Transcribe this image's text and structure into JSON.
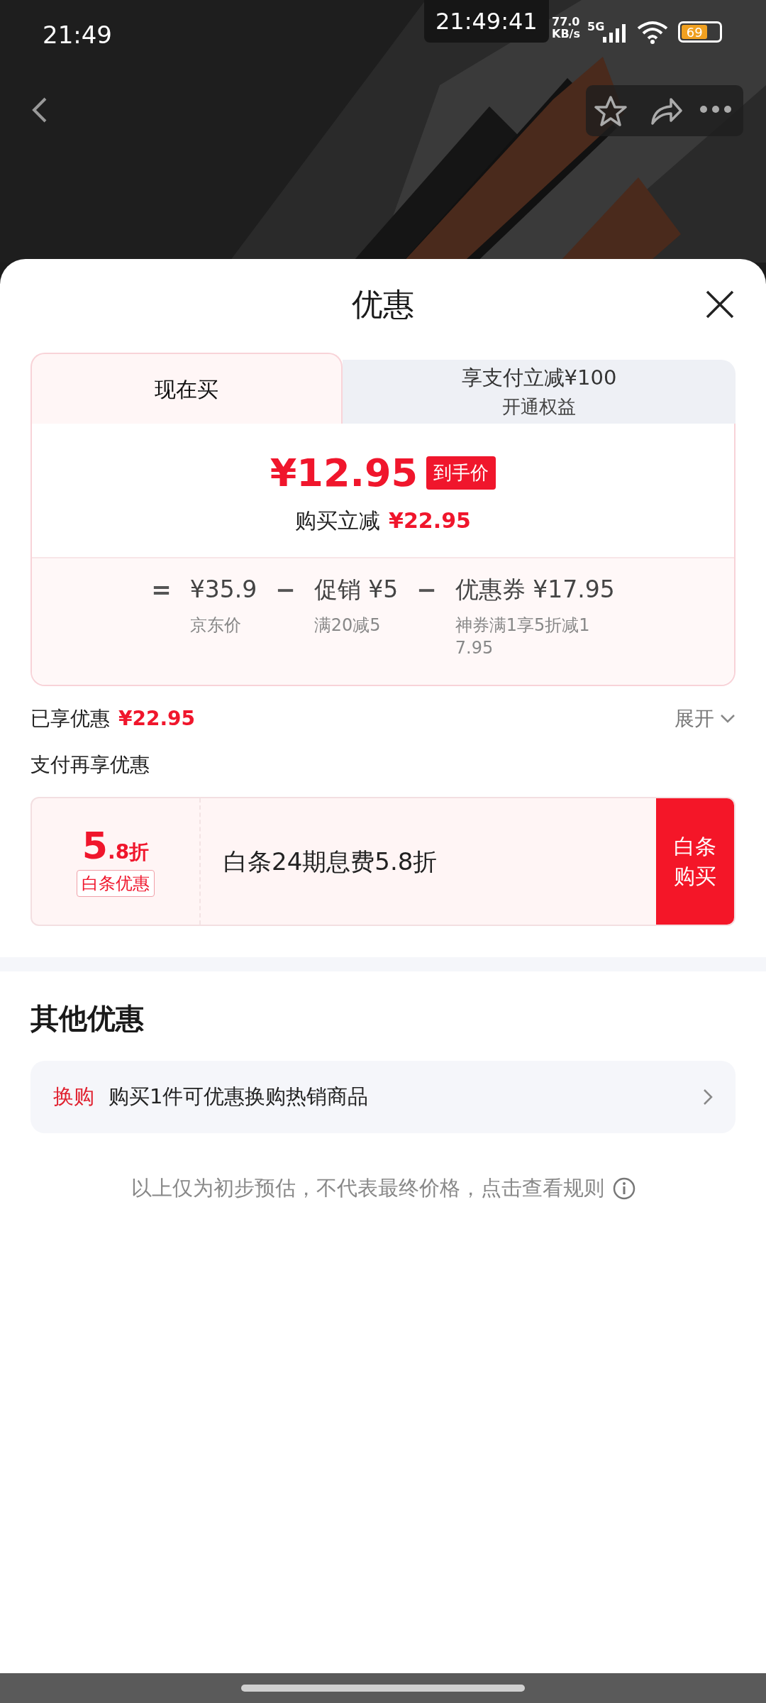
{
  "status_bar": {
    "time": "21:49",
    "floating_clock": "21:49:41",
    "net_speed": [
      "77.0",
      "KB/s"
    ],
    "network": "5G",
    "battery": "69"
  },
  "sheet": {
    "title": "优惠",
    "tabs": [
      {
        "label": "现在买",
        "selected": true
      },
      {
        "label": "享支付立减¥100",
        "sub": "开通权益",
        "selected": false
      }
    ],
    "price": {
      "value": "¥12.95",
      "tag": "到手价",
      "saving_label": "购买立减",
      "saving": "¥22.95"
    },
    "breakdown": [
      {
        "op": "=",
        "amount": "¥35.9",
        "note": "京东价"
      },
      {
        "op": "−",
        "amount": "促销 ¥5",
        "note": "满20减5"
      },
      {
        "op": "−",
        "amount": "优惠券 ¥17.95",
        "note": "神券满1享5折减17.95"
      }
    ],
    "enjoyed": {
      "label": "已享优惠",
      "amount": "¥22.95",
      "expand": "展开"
    },
    "pay_heading": "支付再享优惠",
    "baitiao": {
      "discount_big": "5",
      "discount_small": ".8折",
      "badge": "白条优惠",
      "text": "白条24期息费5.8折",
      "button": "白条购买"
    },
    "other_heading": "其他优惠",
    "other_items": [
      {
        "tag": "换购",
        "text": "购买1件可优惠换购热销商品"
      }
    ],
    "footer": "以上仅为初步预估，不代表最终价格，点击查看规则"
  }
}
